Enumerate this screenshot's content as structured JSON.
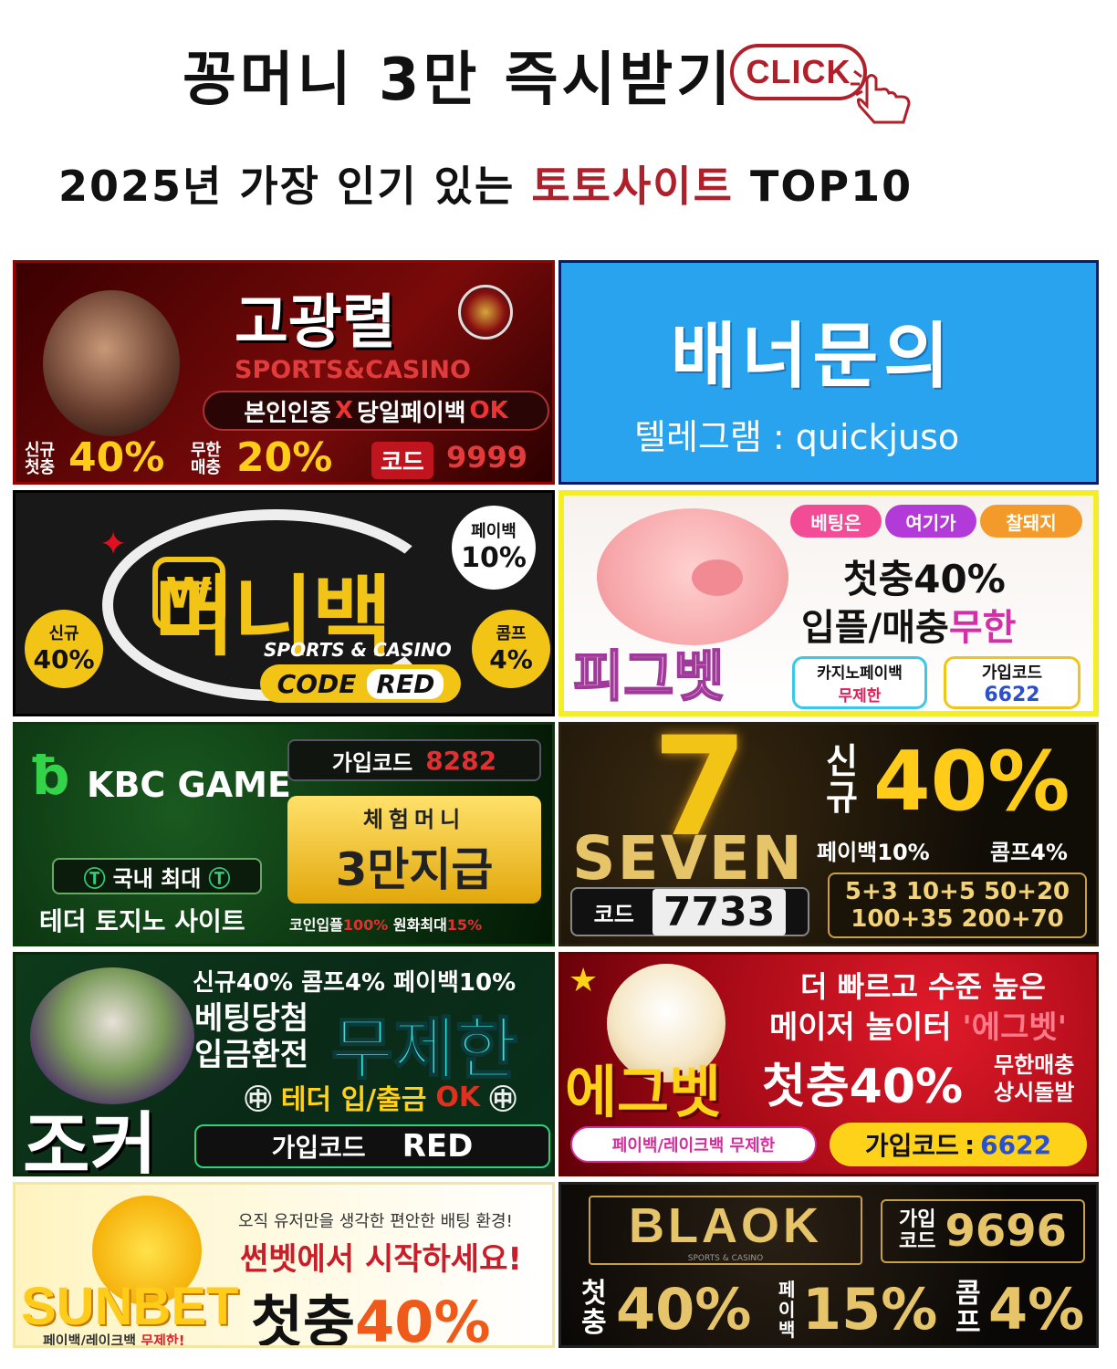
{
  "header": {
    "title": "꽁머니 3만 즉시받기",
    "click": "CLICK",
    "subtitle_pre": "2025년 가장 인기 있는 ",
    "subtitle_red": "토토사이트",
    "subtitle_post": " TOP10"
  },
  "banners": {
    "b1": {
      "name": "고광렬",
      "sub": "SPORTS&CASINO",
      "verify": "본인인증",
      "x": "X",
      "payback": "당일페이백",
      "ok": "OK",
      "new_a": "신규",
      "new_b": "첫충",
      "pct1": "40%",
      "inf_a": "무한",
      "inf_b": "매충",
      "pct2": "20%",
      "code_label": "코드",
      "code": "9999"
    },
    "b2": {
      "title": "배너문의",
      "contact": "텔레그램 : quickjuso"
    },
    "b3": {
      "name": "머니백",
      "sub": "SPORTS & CASINO",
      "code_label": "CODE",
      "code": "RED",
      "pb_label": "페이백",
      "pb": "10%",
      "new_label": "신규",
      "new_pct": "40%",
      "comp_label": "콤프",
      "comp": "4%"
    },
    "b4": {
      "tag1": "베팅은",
      "tag2": "여기가",
      "tag3": "찰돼지",
      "line1": "첫충40%",
      "line2a": "입플/매충",
      "line2b": "무한",
      "name": "피그벳",
      "casino_a": "카지노페이백",
      "casino_b": "무제한",
      "code_label": "가입코드",
      "code": "6622"
    },
    "b5": {
      "name": "KBC GAME",
      "code_label": "가입코드",
      "code": "8282",
      "exp_a": "체험머니",
      "exp_b": "3만지급",
      "tag_a": "국내 최대",
      "tag_b": "테더 토지노 사이트",
      "foot_a": "코인입플",
      "foot_b": "100%",
      "foot_c": "원화최대",
      "foot_d": "15%"
    },
    "b6": {
      "logo": "7",
      "name": "SEVEN",
      "new": "신규",
      "pct": "40%",
      "pb": "페이백10%",
      "comp": "콤프4%",
      "code_label": "코드",
      "code": "7733",
      "row1": "5+3 10+5 50+20",
      "row2": "100+35 200+70"
    },
    "b7": {
      "top": "신규40% 콤프4% 페이백10%",
      "left_a": "베팅당첨",
      "left_b": "입금환전",
      "big": "무제한",
      "tether": "테더 입/출금",
      "ok": "OK",
      "name": "조커",
      "code_label": "가입코드",
      "code": "RED"
    },
    "b8": {
      "line1": "더 빠르고 수준 높은",
      "line2a": "메이저 놀이터",
      "line2b": "'에그벳'",
      "name": "에그벳",
      "first": "첫충40%",
      "side_a": "무한매충",
      "side_b": "상시돌발",
      "pill": "페이백/레이크백 무제한",
      "code_label": "가입코드",
      "code": "6622"
    },
    "b9": {
      "small": "오직 유저만을 생각한 편안한 배팅 환경!",
      "line": "썬벳에서 시작하세요!",
      "name": "SUNBET",
      "first_a": "첫충",
      "first_b": "40%",
      "foot_a": "페이백/레이크백",
      "foot_b": "무제한!"
    },
    "b10": {
      "name": "BLAOK",
      "sub": "SPORTS & CASINO",
      "code_label_a": "가입",
      "code_label_b": "코드",
      "code": "9696",
      "first": "첫충",
      "pct1": "40%",
      "pb": "페이백",
      "pct2": "15%",
      "comp": "콤프",
      "pct3": "4%"
    }
  },
  "colors": {
    "accent_red": "#b0202a",
    "inquiry_blue": "#29a3ee",
    "gold": "#ffcc1a"
  }
}
